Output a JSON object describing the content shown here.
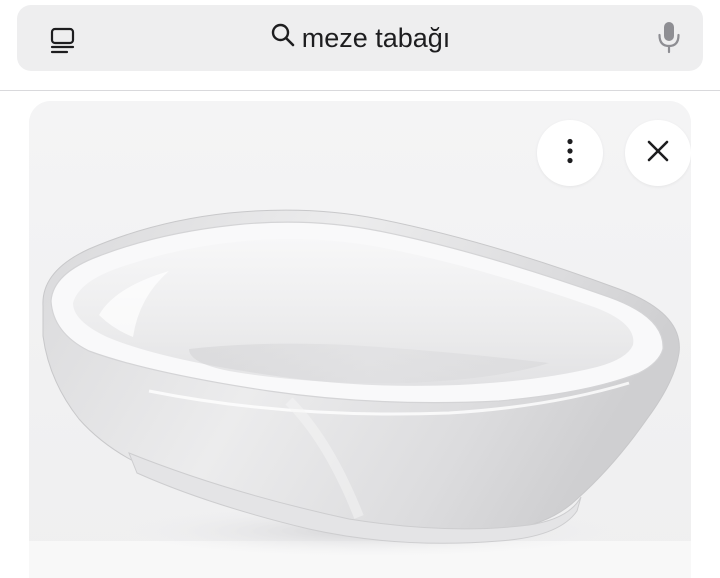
{
  "search": {
    "query": "meze tabağı"
  },
  "icons": {
    "tabs": "tabs-icon",
    "search": "search-icon",
    "mic": "microphone-icon",
    "more": "more-vertical-icon",
    "close": "close-icon"
  },
  "image_card": {
    "subject": "white-rectangular-serving-bowl"
  },
  "colors": {
    "search_bg": "#eeeeef",
    "text": "#1d1d1f",
    "icon_gray": "#8e8e93",
    "card_bg": "#f2f2f3"
  }
}
